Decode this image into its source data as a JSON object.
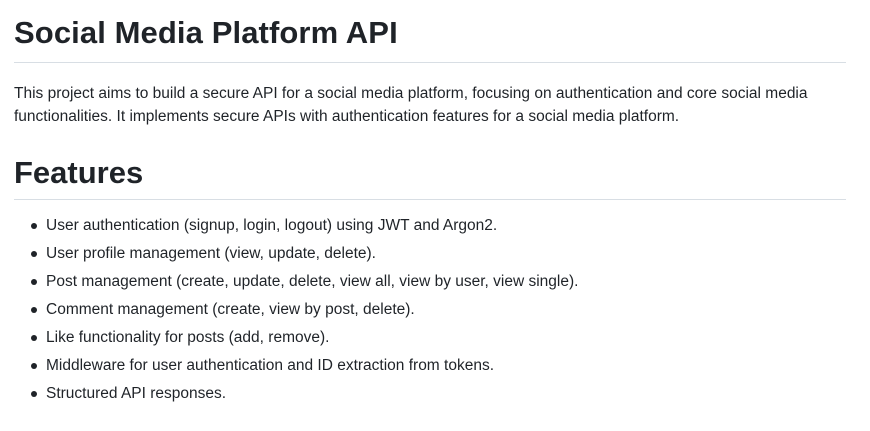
{
  "readme": {
    "title": "Social Media Platform API",
    "description": "This project aims to build a secure API for a social media platform, focusing on authentication and core social media functionalities. It implements secure APIs with authentication features for a social media platform.",
    "features_heading": "Features",
    "features": [
      "User authentication (signup, login, logout) using JWT and Argon2.",
      "User profile management (view, update, delete).",
      "Post management (create, update, delete, view all, view by user, view single).",
      "Comment management (create, view by post, delete).",
      "Like functionality for posts (add, remove).",
      "Middleware for user authentication and ID extraction from tokens.",
      "Structured API responses."
    ]
  }
}
